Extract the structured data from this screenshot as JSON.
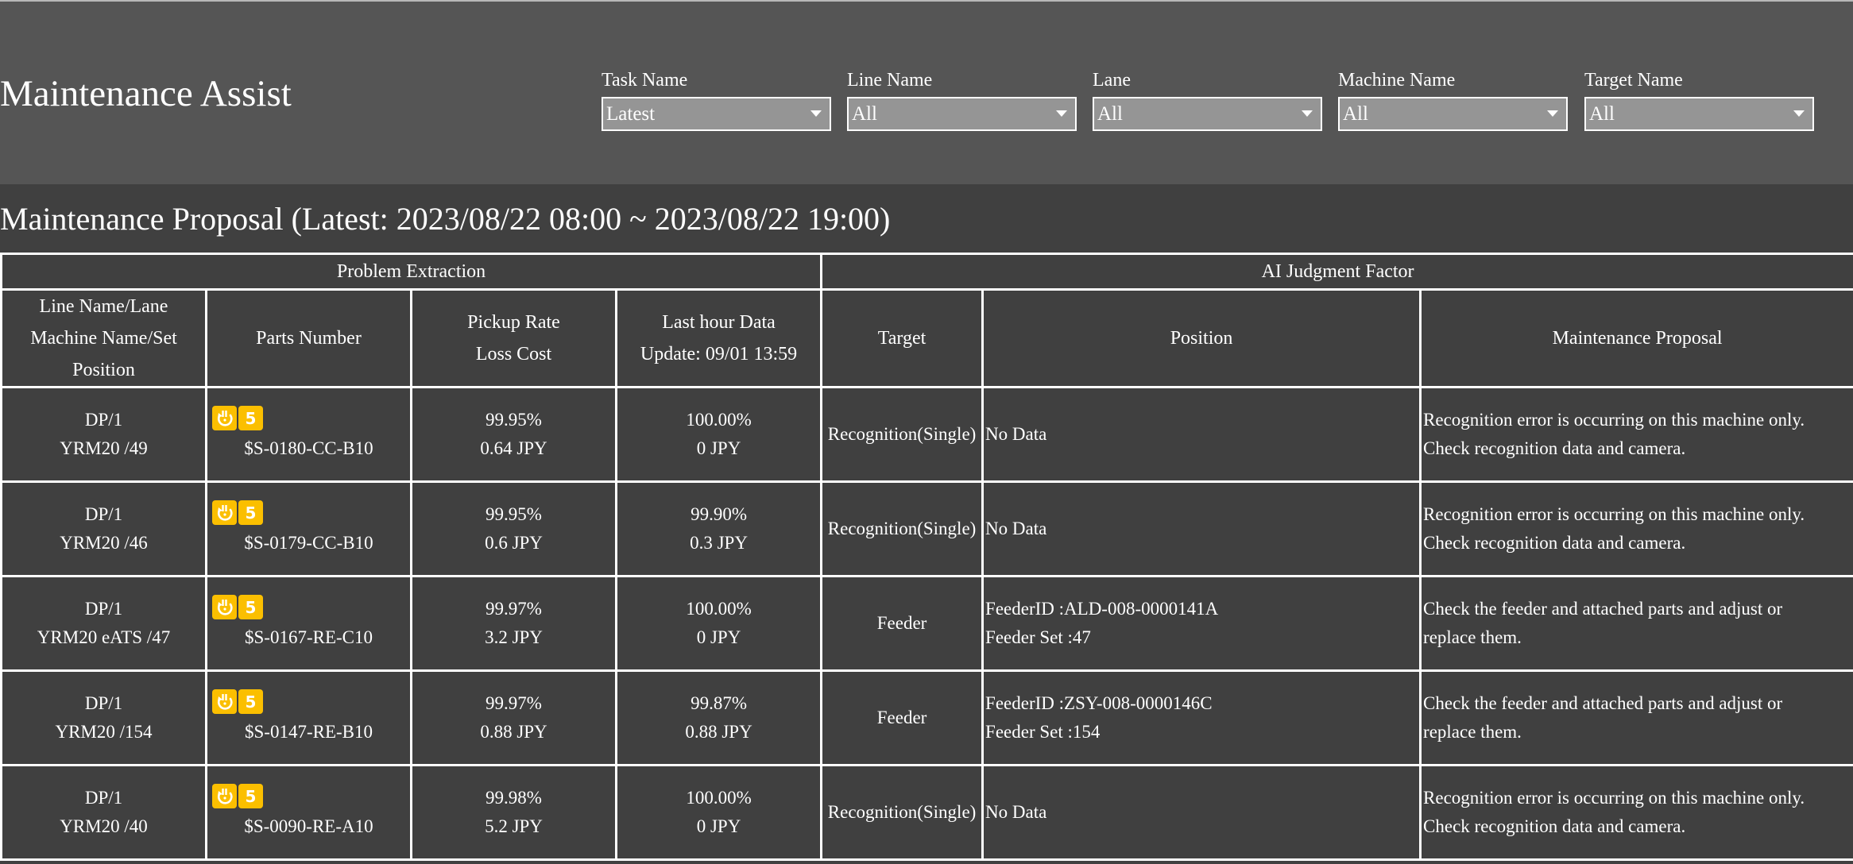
{
  "header": {
    "title": "Maintenance Assist",
    "filters": [
      {
        "label": "Task Name",
        "value": "Latest"
      },
      {
        "label": "Line Name",
        "value": "All"
      },
      {
        "label": "Lane",
        "value": "All"
      },
      {
        "label": "Machine Name",
        "value": "All"
      },
      {
        "label": "Target Name",
        "value": "All"
      }
    ]
  },
  "section_title": "Maintenance Proposal (Latest: 2023/08/22 08:00 ~ 2023/08/22 19:00)",
  "table": {
    "groups": [
      "Problem Extraction",
      "AI Judgment Factor"
    ],
    "columns": {
      "line": [
        "Line Name/Lane",
        "Machine Name/Set",
        "Position"
      ],
      "parts": "Parts Number",
      "pickup": [
        "Pickup Rate",
        "Loss Cost"
      ],
      "lasthour": [
        "Last hour Data",
        "Update: 09/01 13:59"
      ],
      "target": "Target",
      "position": "Position",
      "proposal": "Maintenance Proposal"
    },
    "rows": [
      {
        "line": "DP/1",
        "machine_set": "YRM20 /49",
        "badge_icon": "alert-recycle-icon",
        "badge_count": "5",
        "parts_number": "$S-0180-CC-B10",
        "pickup_rate": "99.95%",
        "loss_cost": "0.64 JPY",
        "last_rate": "100.00%",
        "last_cost": "0 JPY",
        "target": "Recognition(Single)",
        "position": [
          "No Data"
        ],
        "proposal": [
          "Recognition error is occurring on this machine only.",
          "Check recognition data and camera."
        ]
      },
      {
        "line": "DP/1",
        "machine_set": "YRM20 /46",
        "badge_icon": "alert-recycle-icon",
        "badge_count": "5",
        "parts_number": "$S-0179-CC-B10",
        "pickup_rate": "99.95%",
        "loss_cost": "0.6 JPY",
        "last_rate": "99.90%",
        "last_cost": "0.3 JPY",
        "target": "Recognition(Single)",
        "position": [
          "No Data"
        ],
        "proposal": [
          "Recognition error is occurring on this machine only.",
          "Check recognition data and camera."
        ]
      },
      {
        "line": "DP/1",
        "machine_set": "YRM20 eATS /47",
        "badge_icon": "alert-recycle-icon",
        "badge_count": "5",
        "parts_number": "$S-0167-RE-C10",
        "pickup_rate": "99.97%",
        "loss_cost": "3.2 JPY",
        "last_rate": "100.00%",
        "last_cost": "0 JPY",
        "target": "Feeder",
        "position": [
          "FeederID :ALD-008-0000141A",
          "Feeder Set :47"
        ],
        "proposal": [
          "Check the feeder and attached parts and adjust or",
          "replace them."
        ]
      },
      {
        "line": "DP/1",
        "machine_set": "YRM20 /154",
        "badge_icon": "alert-recycle-icon",
        "badge_count": "5",
        "parts_number": "$S-0147-RE-B10",
        "pickup_rate": "99.97%",
        "loss_cost": "0.88 JPY",
        "last_rate": "99.87%",
        "last_cost": "0.88 JPY",
        "target": "Feeder",
        "position": [
          "FeederID :ZSY-008-0000146C",
          "Feeder Set :154"
        ],
        "proposal": [
          "Check the feeder and attached parts and adjust or",
          "replace them."
        ]
      },
      {
        "line": "DP/1",
        "machine_set": "YRM20 /40",
        "badge_icon": "alert-recycle-icon",
        "badge_count": "5",
        "parts_number": "$S-0090-RE-A10",
        "pickup_rate": "99.98%",
        "loss_cost": "5.2 JPY",
        "last_rate": "100.00%",
        "last_cost": "0 JPY",
        "target": "Recognition(Single)",
        "position": [
          "No Data"
        ],
        "proposal": [
          "Recognition error is occurring on this machine only.",
          "Check recognition data and camera."
        ]
      }
    ]
  },
  "colors": {
    "header_bg": "#555555",
    "body_bg": "#404040",
    "select_bg": "#959595",
    "badge": "#fbbf00",
    "border": "#ffffff"
  }
}
